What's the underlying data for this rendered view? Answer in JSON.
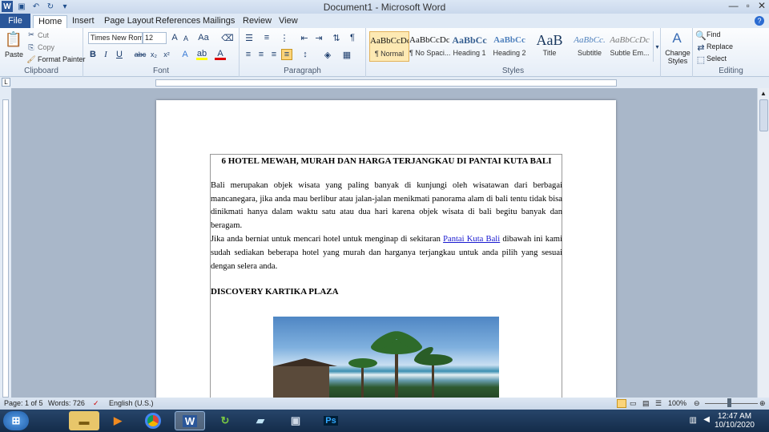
{
  "window": {
    "title": "Document1 - Microsoft Word"
  },
  "tabs": [
    "File",
    "Home",
    "Insert",
    "Page Layout",
    "References",
    "Mailings",
    "Review",
    "View"
  ],
  "clipboard": {
    "paste": "Paste",
    "cut": "Cut",
    "copy": "Copy",
    "format_painter": "Format Painter",
    "label": "Clipboard"
  },
  "font": {
    "name": "Times New Rom",
    "size": "12",
    "label": "Font"
  },
  "paragraph": {
    "label": "Paragraph"
  },
  "styles": {
    "label": "Styles",
    "items": [
      {
        "preview": "AaBbCcDc",
        "name": "¶ Normal"
      },
      {
        "preview": "AaBbCcDc",
        "name": "¶ No Spaci..."
      },
      {
        "preview": "AaBbCc",
        "name": "Heading 1"
      },
      {
        "preview": "AaBbCc",
        "name": "Heading 2"
      },
      {
        "preview": "AaB",
        "name": "Title"
      },
      {
        "preview": "AaBbCc.",
        "name": "Subtitle"
      },
      {
        "preview": "AaBbCcDc",
        "name": "Subtle Em..."
      }
    ],
    "change": "Change Styles"
  },
  "editing": {
    "label": "Editing",
    "find": "Find",
    "replace": "Replace",
    "select": "Select"
  },
  "doc": {
    "heading": "6 HOTEL MEWAH, MURAH DAN HARGA TERJANGKAU DI PANTAI KUTA BALI",
    "p1": "Bali merupakan objek wisata yang paling banyak di kunjungi oleh wisatawan dari berbagai mancanegara, jika anda mau berlibur atau jalan-jalan menikmati panorama alam di bali tentu tidak bisa dinikmati hanya dalam waktu satu atau dua hari karena objek wisata di bali begitu banyak dan beragam.",
    "p2_pre": "Jika anda berniat untuk mencari hotel untuk menginap di sekitaran ",
    "p2_link": "Pantai Kuta Bali",
    "p2_post": " dibawah ini kami sudah sediakan beberapa hotel yang murah dan harganya terjangkau untuk anda pilih yang sesuai dengan selera anda.",
    "subheading": "DISCOVERY KARTIKA PLAZA"
  },
  "status": {
    "page": "Page: 1 of 5",
    "words": "Words: 726",
    "language": "English (U.S.)",
    "zoom": "100%"
  },
  "clock": {
    "time": "12:47 AM",
    "date": "10/10/2020"
  }
}
